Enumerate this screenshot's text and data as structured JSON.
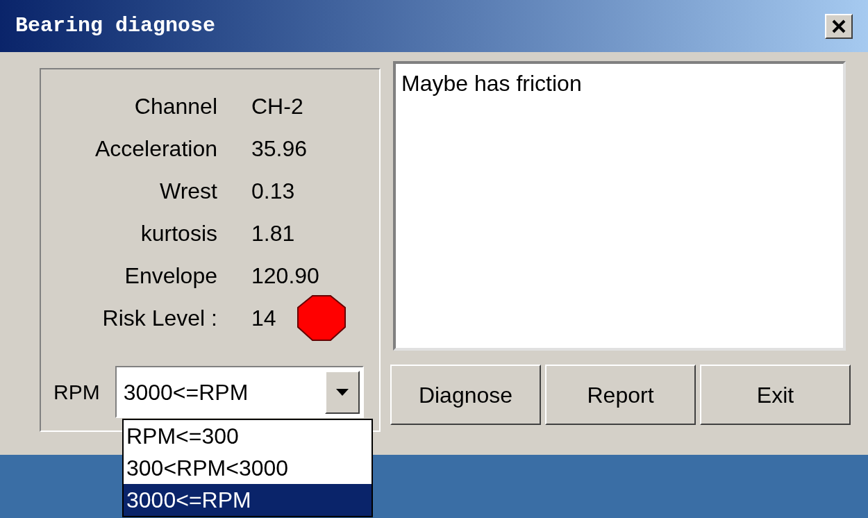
{
  "window": {
    "title": "Bearing diagnose"
  },
  "readings": [
    {
      "label": "Channel",
      "value": "CH-2"
    },
    {
      "label": "Acceleration",
      "value": "35.96"
    },
    {
      "label": "Wrest",
      "value": "0.13"
    },
    {
      "label": "kurtosis",
      "value": "1.81"
    },
    {
      "label": "Envelope",
      "value": "120.90"
    },
    {
      "label": "Risk Level :",
      "value": "14",
      "kind": "risk"
    }
  ],
  "rpm": {
    "label": "RPM",
    "value": "3000<=RPM",
    "expanded": true,
    "options": [
      {
        "label": "RPM<=300",
        "selected": false
      },
      {
        "label": "300<RPM<3000",
        "selected": false
      },
      {
        "label": "3000<=RPM",
        "selected": true
      }
    ]
  },
  "result_text": "Maybe has friction",
  "buttons": [
    "Diagnose",
    "Report",
    "Exit"
  ]
}
